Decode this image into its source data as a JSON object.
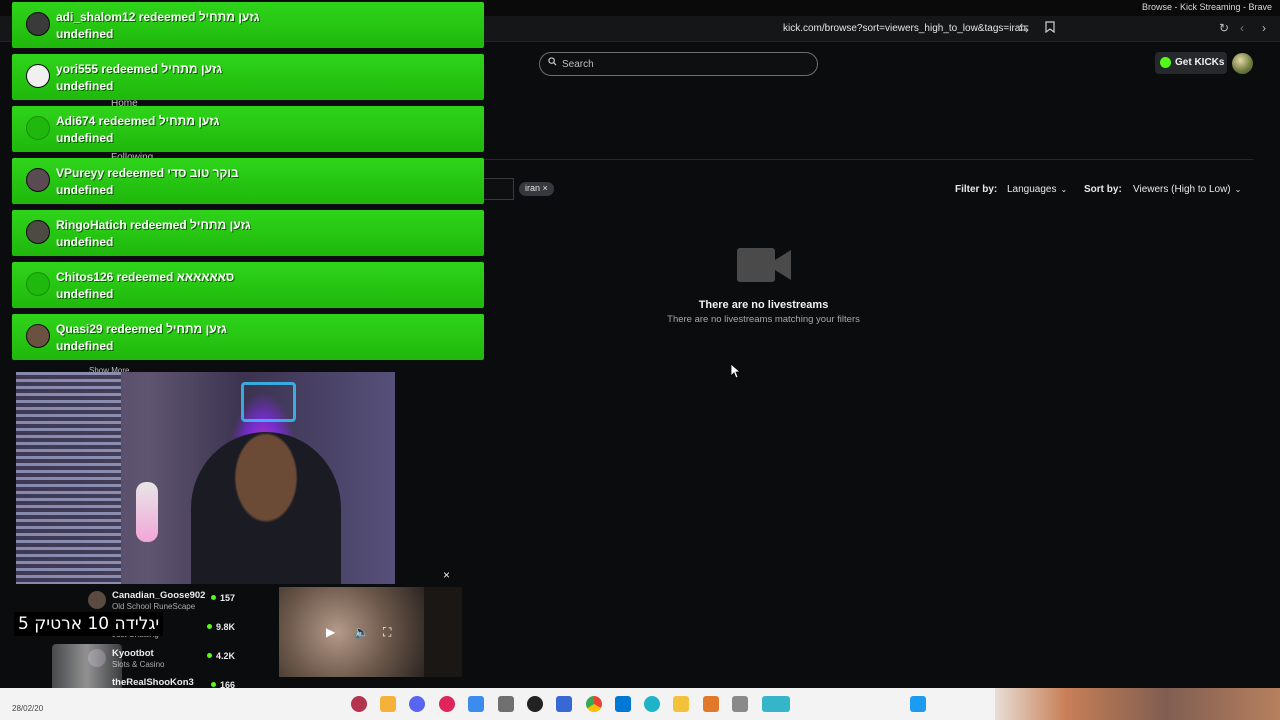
{
  "window": {
    "title": "Browse - Kick Streaming - Brave"
  },
  "address_bar": {
    "url": "kick.com/browse?sort=viewers_high_to_low&tags=iran"
  },
  "header": {
    "search_placeholder": "Search",
    "get_kicks_label": "Get KICKs"
  },
  "sidebar_ghost": {
    "home": "Home",
    "following": "Following",
    "show_more": "Show More"
  },
  "filters": {
    "tag": "iran ×",
    "filter_by_label": "Filter by:",
    "languages_label": "Languages",
    "sort_by_label": "Sort by:",
    "sort_value": "Viewers (High to Low)"
  },
  "empty_state": {
    "title": "There are no livestreams",
    "subtitle": "There are no livestreams matching your filters"
  },
  "alerts": [
    {
      "text": "adi_shalom12 redeemed גזען מתחיל",
      "sub": "undefined"
    },
    {
      "text": "yori555 redeemed גזען מתחיל",
      "sub": "undefined"
    },
    {
      "text": "Adi674 redeemed גזען מתחיל",
      "sub": "undefined"
    },
    {
      "text": "VPureyy redeemed בוקר טוב סדי",
      "sub": "undefined"
    },
    {
      "text": "RingoHatich redeemed גזען מתחיל",
      "sub": "undefined"
    },
    {
      "text": "Chitos126 redeemed סאאאאאא",
      "sub": "undefined"
    },
    {
      "text": "Quasi29 redeemed גזען מתחיל",
      "sub": "undefined"
    }
  ],
  "recommended": [
    {
      "name": "Canadian_Goose902",
      "category": "Old School RuneScape",
      "viewers": "157"
    },
    {
      "name": "",
      "category": "Just Chatting",
      "viewers": "9.8K"
    },
    {
      "name": "Kyootbot",
      "category": "Slots & Casino",
      "viewers": "4.2K"
    },
    {
      "name": "theRealShooKon3",
      "category": "",
      "viewers": "166"
    }
  ],
  "overlay_text": "יגלידה 10 ארטיק 5",
  "taskbar": {
    "date": "28/02/20"
  },
  "colors": {
    "alert_green": "#2fd41a",
    "kick_green": "#53fc18",
    "background": "#0b0c0e"
  }
}
